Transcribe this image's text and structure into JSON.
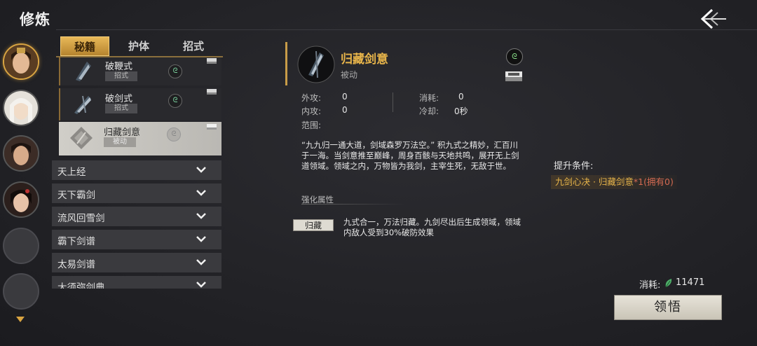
{
  "header": {
    "title": "修炼"
  },
  "avatars": [
    {
      "state": "selected",
      "tone": "#c98a50"
    },
    {
      "state": "normal",
      "tone": "#d9d4cc"
    },
    {
      "state": "normal",
      "tone": "#6b4a3a"
    },
    {
      "state": "normal",
      "tone": "#4a3530"
    },
    {
      "state": "empty"
    },
    {
      "state": "empty"
    }
  ],
  "tabs": [
    {
      "label": "秘籍",
      "active": true
    },
    {
      "label": "护体",
      "active": false
    },
    {
      "label": "招式",
      "active": false
    }
  ],
  "skills": [
    {
      "name": "破鞭式",
      "tag": "招式",
      "rune": "ᘓ",
      "selected": false
    },
    {
      "name": "破剑式",
      "tag": "招式",
      "rune": "ᘓ",
      "selected": false
    },
    {
      "name": "归藏剑意",
      "tag": "被动",
      "rune": "ᘓ",
      "selected": true
    }
  ],
  "categories": [
    "天上经",
    "天下霸剑",
    "流风回雪剑",
    "霸下剑谱",
    "太易剑谱",
    "大须弥剑典"
  ],
  "detail": {
    "name": "归藏剑意",
    "type": "被动",
    "rune": "ᘓ",
    "stats": {
      "outer_attack_label": "外攻:",
      "outer_attack": "0",
      "inner_attack_label": "内攻:",
      "inner_attack": "0",
      "cost_label": "消耗:",
      "cost": "0",
      "cooldown_label": "冷却:",
      "cooldown": "0秒",
      "range_label": "范围:"
    },
    "description": "“九九归一通大道，剑域森罗万法空。” 积九式之精妙，汇百川于一海。当剑意推至巅峰，周身百骸与天地共鸣，展开无上剑道领域。领域之内，万物皆为我剑，主宰生死，无敌于世。",
    "enhance_title": "强化属性",
    "enhance_tag": "归藏",
    "enhance_desc": "九式合一，万法归藏。九剑尽出后生成领域，领域内敌人受到30%破防效果"
  },
  "requirements": {
    "title": "提升条件:",
    "item_name": "九剑心决 · 归藏剑意",
    "item_count": "*1(拥有0)"
  },
  "footer": {
    "cost_label": "消耗:",
    "cost_value": "11471",
    "learn_label": "领悟"
  },
  "colors": {
    "accent_gold": "#e8b54a",
    "warning_red": "#d46a52"
  }
}
